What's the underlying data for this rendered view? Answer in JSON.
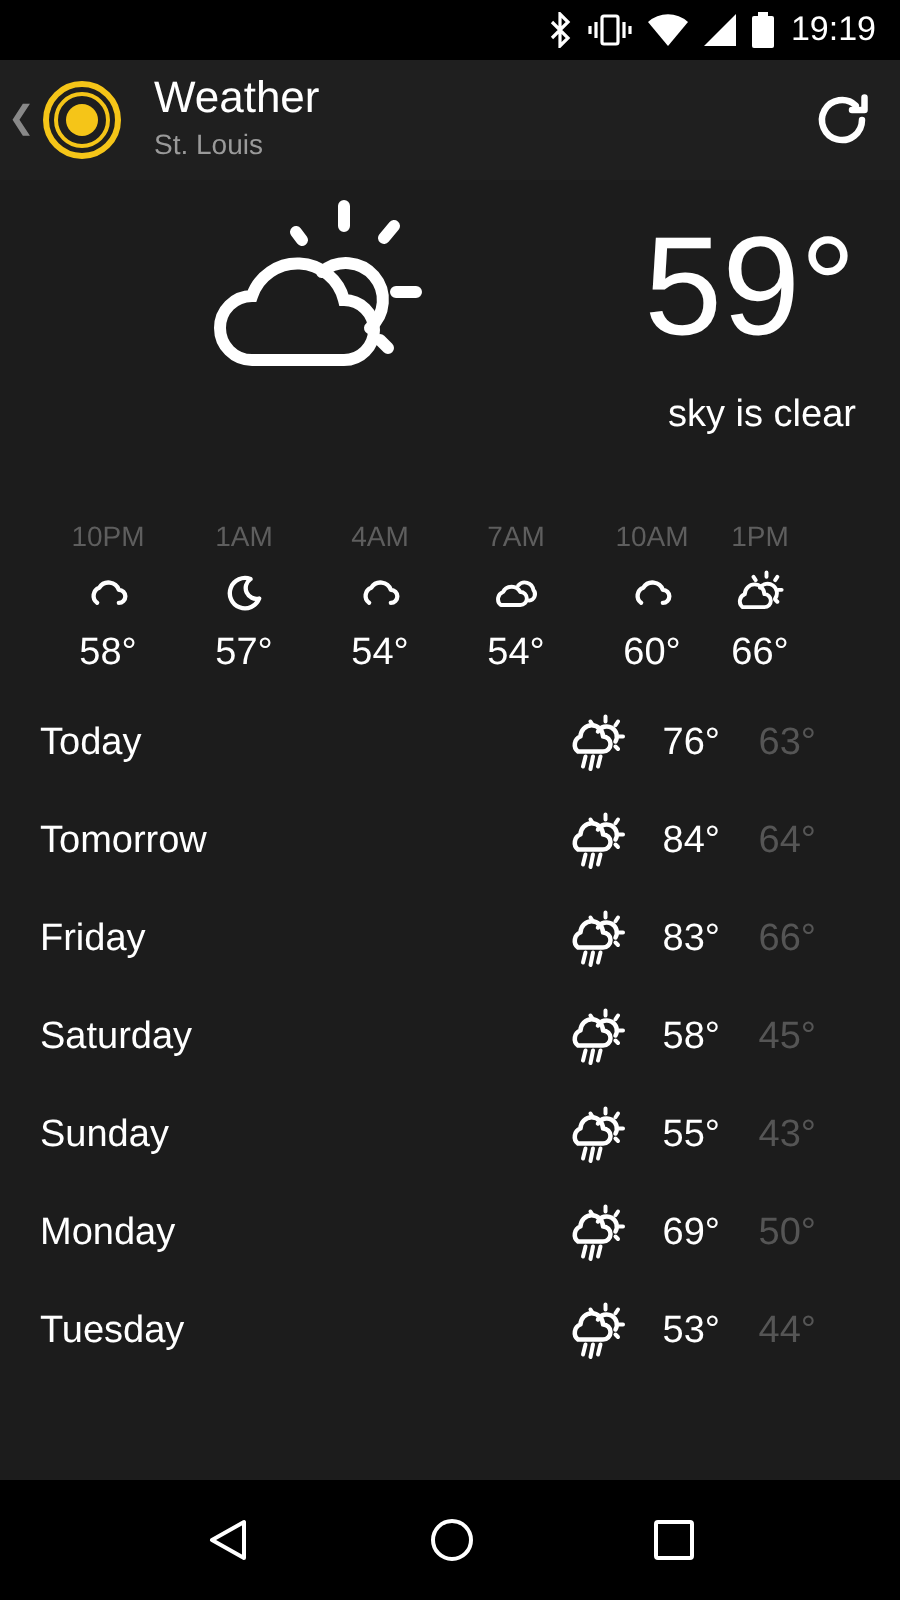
{
  "status_bar": {
    "time": "19:19"
  },
  "app_bar": {
    "back": "❮",
    "title": "Weather",
    "subtitle": "St. Louis"
  },
  "current": {
    "temperature": "59°",
    "condition": "sky is clear"
  },
  "hourly": [
    {
      "time": "10PM",
      "kind": "cloud",
      "temp": "58°"
    },
    {
      "time": "1AM",
      "kind": "moon",
      "temp": "57°"
    },
    {
      "time": "4AM",
      "kind": "cloud",
      "temp": "54°"
    },
    {
      "time": "7AM",
      "kind": "clouds",
      "temp": "54°"
    },
    {
      "time": "10AM",
      "kind": "cloud",
      "temp": "60°"
    },
    {
      "time": "1PM",
      "kind": "sun-cloud",
      "temp": "66°"
    }
  ],
  "daily": [
    {
      "day": "Today",
      "kind": "rain-sun",
      "high": "76°",
      "low": "63°"
    },
    {
      "day": "Tomorrow",
      "kind": "rain-sun",
      "high": "84°",
      "low": "64°"
    },
    {
      "day": "Friday",
      "kind": "rain-sun",
      "high": "83°",
      "low": "66°"
    },
    {
      "day": "Saturday",
      "kind": "rain-sun",
      "high": "58°",
      "low": "45°"
    },
    {
      "day": "Sunday",
      "kind": "rain-sun",
      "high": "55°",
      "low": "43°"
    },
    {
      "day": "Monday",
      "kind": "rain-sun",
      "high": "69°",
      "low": "50°"
    },
    {
      "day": "Tuesday",
      "kind": "rain-sun",
      "high": "53°",
      "low": "44°"
    }
  ]
}
